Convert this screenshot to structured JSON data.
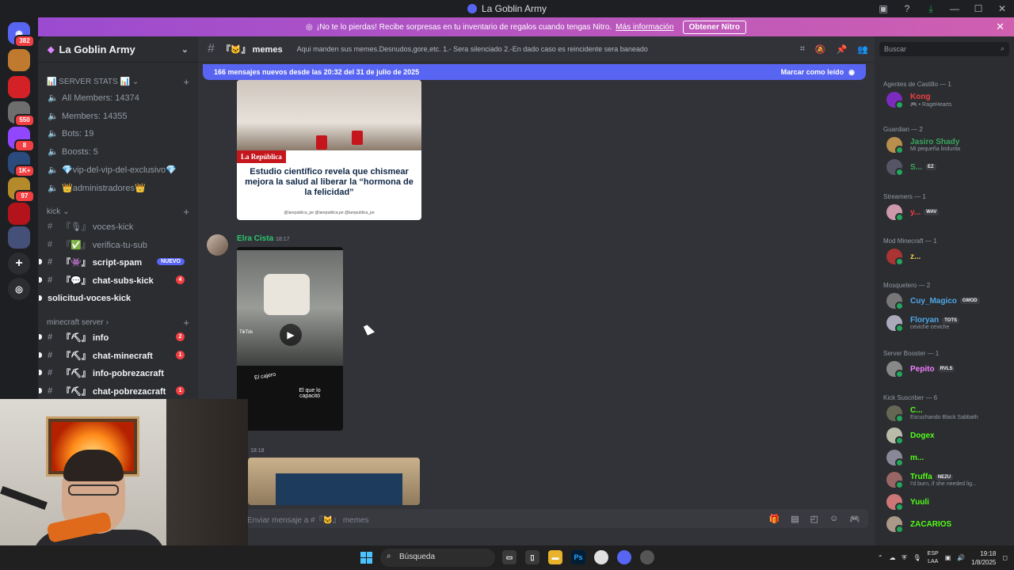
{
  "window": {
    "title": "La Goblin Army"
  },
  "colors": {
    "accent": "#5865f2",
    "online": "#23a55a",
    "danger": "#f23f42",
    "nitro_start": "#9b4bd0",
    "nitro_end": "#d05fb0"
  },
  "servers": [
    {
      "badge": "382",
      "color": "#5865f2",
      "icon": "discord-icon"
    },
    {
      "badge": "",
      "color": "#c07a2f"
    },
    {
      "badge": "",
      "color": "#d42027"
    },
    {
      "badge": "550",
      "color": "#6e6e6e"
    },
    {
      "badge": "8",
      "color": "#9146ff"
    },
    {
      "badge": "1K+",
      "color": "#2b4b7d"
    },
    {
      "badge": "97",
      "color": "#b58a2a"
    },
    {
      "badge": "",
      "color": "#b3141b"
    },
    {
      "badge": "",
      "color": "#445077"
    }
  ],
  "nitro": {
    "message": "¡No te lo pierdas! Recibe sorpresas en tu inventario de regalos cuando tengas Nitro.",
    "link": "Más información",
    "button": "Obtener Nitro"
  },
  "guild": {
    "name": "La Goblin Army"
  },
  "sidebar": {
    "cat_stats": "📊 SERVER STATS 📊",
    "stats": [
      "All Members: 14374",
      "Members: 14355",
      "Bots: 19",
      "Boosts: 5",
      "💎vip-del-vip-del-exclusivo💎",
      "👑administradores👑"
    ],
    "cat_kick": "kick",
    "kick_channels": [
      {
        "glyph": "#",
        "name": "『🎙』 voces-kick",
        "unread": false,
        "badge": ""
      },
      {
        "glyph": "#",
        "name": "『✅』 verifica-tu-sub",
        "unread": false,
        "badge": ""
      },
      {
        "glyph": "#",
        "name": "『👾』 script-spam",
        "unread": true,
        "badge": "NUEVO"
      },
      {
        "glyph": "#",
        "name": "『💬』 chat-subs-kick",
        "unread": true,
        "badge": "4"
      },
      {
        "glyph": "",
        "name": "solicitud-voces-kick",
        "unread": true,
        "badge": ""
      }
    ],
    "cat_mc": "minecraft server",
    "mc_channels": [
      {
        "glyph": "#",
        "name": "『⛏』 info",
        "badge": "2"
      },
      {
        "glyph": "#",
        "name": "『⛏』 chat-minecraft",
        "badge": "1"
      },
      {
        "glyph": "#",
        "name": "『⛏』 info-pobrezacraft",
        "badge": ""
      },
      {
        "glyph": "#",
        "name": "『⛏』 chat-pobrezacraft",
        "badge": "1"
      }
    ]
  },
  "channel": {
    "name": "『🐱』 memes",
    "topic": "Aqui manden sus memes.Desnudos,gore,etc. 1.- Sera silenciado 2.-En dado caso es reincidente sera baneado"
  },
  "new_messages": {
    "text": "166 mensajes nuevos desde las 20:32 del 31 de julio de 2025",
    "mark": "Marcar como leído"
  },
  "article": {
    "publisher": "La República",
    "headline": "Estudio científico revela que chismear mejora la salud al liberar la “hormona de la felicidad”",
    "handles": "@larepublica_pe   @larepublica.pe   @larepublica_pe"
  },
  "message": {
    "author": "Elra Cista",
    "time": "18:17",
    "tiktok": "TikTok",
    "caption1": "El cajero",
    "caption2": "El que lo capacitó"
  },
  "message2": {
    "time": "18:18"
  },
  "composer": {
    "placeholder": "Enviar mensaje a #『🐱』 memes"
  },
  "members": {
    "search_placeholder": "Buscar",
    "groups": [
      {
        "title": "Agentes de Castillo — 1",
        "items": [
          {
            "name": "Kong",
            "color": "#f23f42",
            "sub": "🎮 • RageHearts",
            "tag": ""
          }
        ]
      },
      {
        "title": "Guardian — 2",
        "items": [
          {
            "name": "Jasiro Shady",
            "color": "#3ba55d",
            "sub": "Mi pequeña lindurita",
            "tag": ""
          },
          {
            "name": "S...",
            "color": "#3ba55d",
            "sub": "",
            "tag": "EZ"
          }
        ]
      },
      {
        "title": "Streamers — 1",
        "items": [
          {
            "name": "y...",
            "color": "#f23f42",
            "sub": "",
            "tag": "WAV"
          }
        ]
      },
      {
        "title": "Mod Minecraft — 1",
        "items": [
          {
            "name": "z...",
            "color": "#f2c94c",
            "sub": "",
            "tag": ""
          }
        ]
      },
      {
        "title": "Mosquetero — 2",
        "items": [
          {
            "name": "Cuy_Magico",
            "color": "#4fa8e8",
            "sub": "",
            "tag": "GMOD"
          },
          {
            "name": "Floryan",
            "color": "#4fa8e8",
            "sub": "ceviche ceviche",
            "tag": "TOTS"
          }
        ]
      },
      {
        "title": "Server Booster — 1",
        "items": [
          {
            "name": "Pepito",
            "color": "#f47fff",
            "sub": "",
            "tag": "RVLS"
          }
        ]
      },
      {
        "title": "Kick Suscriber — 6",
        "items": [
          {
            "name": "C...",
            "color": "#53fc18",
            "sub": "Escuchando Black Sabbath",
            "tag": ""
          },
          {
            "name": "Dogex",
            "color": "#53fc18",
            "sub": "",
            "tag": ""
          },
          {
            "name": "m...",
            "color": "#53fc18",
            "sub": "",
            "tag": ""
          },
          {
            "name": "Truffa",
            "color": "#53fc18",
            "sub": "I'd burn, if she needed lig...",
            "tag": "NEZU"
          },
          {
            "name": "Yuuli",
            "color": "#53fc18",
            "sub": "",
            "tag": ""
          },
          {
            "name": "ZACARIOS",
            "color": "#53fc18",
            "sub": "",
            "tag": ""
          }
        ]
      }
    ]
  },
  "taskbar": {
    "search": "Búsqueda",
    "lang": "ESP",
    "lang2": "LAA",
    "time": "19:18",
    "date": "1/8/2025"
  }
}
